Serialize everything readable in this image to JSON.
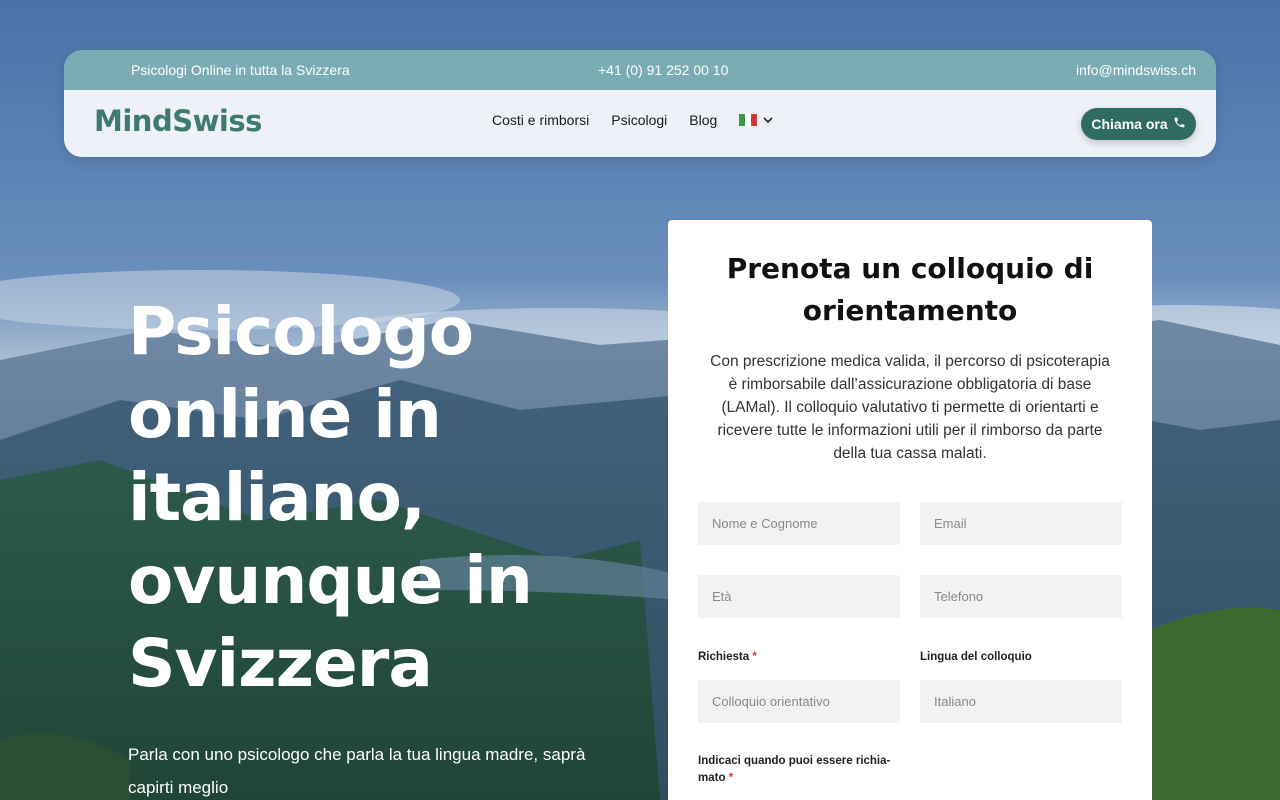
{
  "topbar": {
    "tagline": "Psicologi Online in tutta la Svizzera",
    "phone": "+41 (0) 91 252 00 10",
    "email": "info@mindswiss.ch"
  },
  "navbar": {
    "logo": "MindSwiss",
    "items": [
      "Costi e rimborsi",
      "Psicologi",
      "Blog"
    ],
    "language_icon": "italy-flag-icon",
    "call_button": "Chiama ora",
    "call_icon": "phone-icon"
  },
  "hero": {
    "title": "Psicologo online in italiano, ovunque in Svizzera",
    "subtitle": "Parla con uno psicologo che parla la tua lingua madre, saprà capirti meglio"
  },
  "form": {
    "title": "Prenota un colloquio di orientamento",
    "description": "Con prescrizione medica valida, il percorso di psicoterapia è rimborsabile dall’assicurazione obbligatoria di base (LAMal). Il colloquio valutativo ti permette di orientarti e ricevere tutte le informazioni utili per il rimborso da parte della tua cassa malati.",
    "name_placeholder": "Nome e Cognome",
    "email_placeholder": "Email",
    "age_placeholder": "Età",
    "phone_placeholder": "Telefono",
    "request_label": "Richiesta",
    "request_value": "Colloquio orientativo",
    "language_label": "Lingua del colloquio",
    "language_value": "Italiano",
    "availability_label_1": "Indicaci quando puoi essere richia-",
    "availability_label_2": "mato",
    "required_mark": "*"
  },
  "colors": {
    "brand": "#3f7a72",
    "button": "#2f6b62",
    "topbar": "#7aacb3",
    "navbar": "#eef1f7"
  }
}
